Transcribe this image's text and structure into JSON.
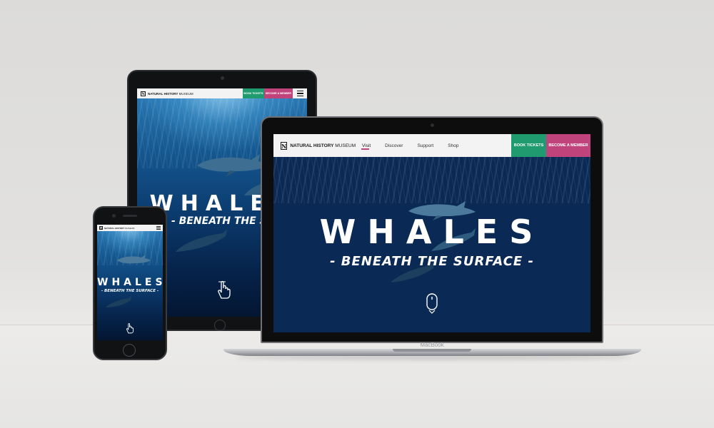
{
  "brand": {
    "logo_mark": "N",
    "logo_bold": "NATURAL HISTORY",
    "logo_light": "MUSEUM",
    "tickets_color": "#1f9b6f",
    "member_color": "#c1437c"
  },
  "laptop": {
    "nav": [
      "Visit",
      "Discover",
      "Support",
      "Shop"
    ],
    "active_nav": "Visit",
    "book_tickets": "BOOK TICKETS",
    "become_member": "BECOME A MEMBER",
    "hero_title": "WHALES",
    "hero_subtitle": "- BENEATH THE SURFACE -",
    "scroll_icon": "mouse-scroll-icon",
    "device_label": "MacBook"
  },
  "tablet": {
    "book_tickets": "BOOK TICKETS",
    "become_member": "BECOME A MEMBER",
    "hero_title": "WHALES",
    "hero_subtitle": "- BENEATH THE SURFAC",
    "scroll_icon": "touch-swipe-icon",
    "menu_icon": "hamburger-icon"
  },
  "phone": {
    "hero_title": "WHALES",
    "hero_subtitle": "- BENEATH THE SURFACE -",
    "scroll_icon": "touch-swipe-icon",
    "menu_icon": "hamburger-icon"
  }
}
